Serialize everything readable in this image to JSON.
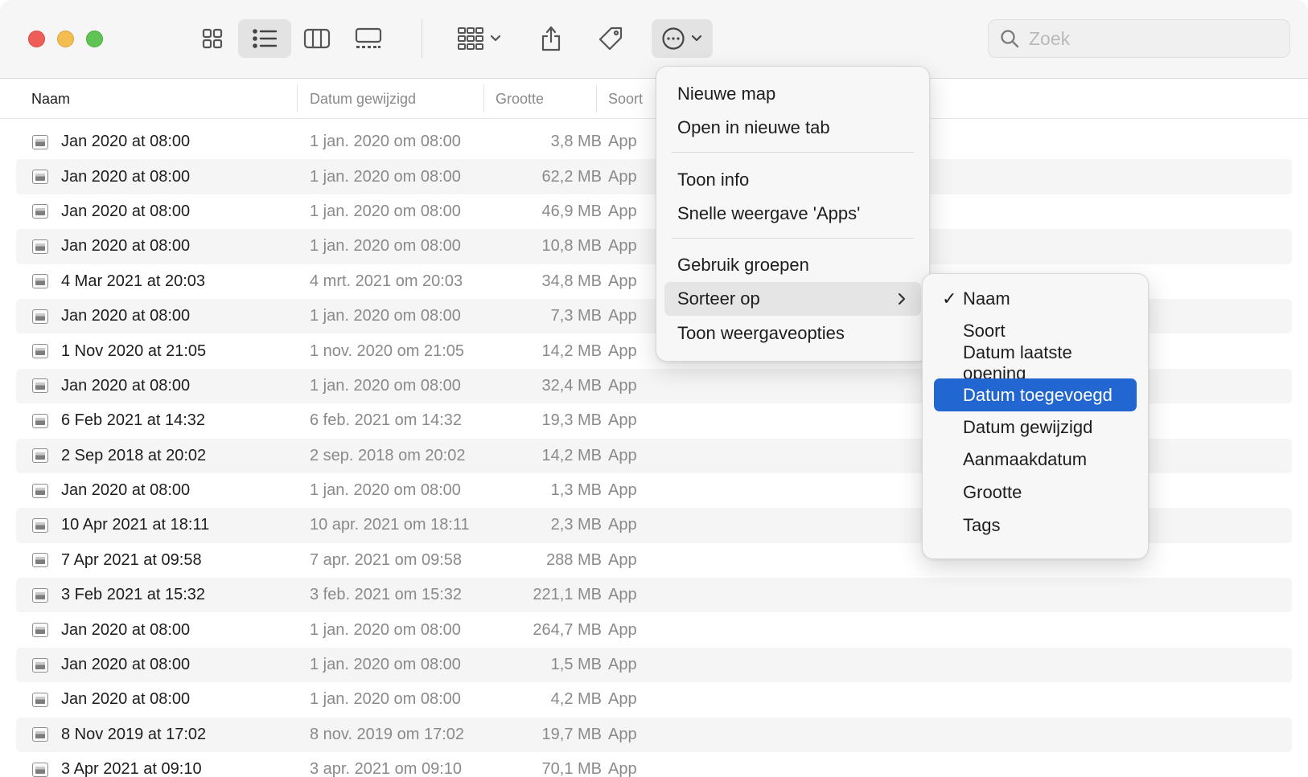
{
  "toolbar": {
    "view_icons": [
      "icon-view-icon",
      "list-view-icon",
      "column-view-icon",
      "gallery-view-icon"
    ],
    "search_placeholder": "Zoek"
  },
  "columns": {
    "name": "Naam",
    "date": "Datum gewijzigd",
    "size": "Grootte",
    "kind": "Soort"
  },
  "rows": [
    {
      "name": "Jan 2020 at 08:00",
      "date": "1 jan. 2020 om 08:00",
      "size": "3,8 MB",
      "kind": "App"
    },
    {
      "name": "Jan 2020 at 08:00",
      "date": "1 jan. 2020 om 08:00",
      "size": "62,2 MB",
      "kind": "App"
    },
    {
      "name": "Jan 2020 at 08:00",
      "date": "1 jan. 2020 om 08:00",
      "size": "46,9 MB",
      "kind": "App"
    },
    {
      "name": "Jan 2020 at 08:00",
      "date": "1 jan. 2020 om 08:00",
      "size": "10,8 MB",
      "kind": "App"
    },
    {
      "name": "4 Mar 2021 at 20:03",
      "date": "4 mrt. 2021 om 20:03",
      "size": "34,8 MB",
      "kind": "App"
    },
    {
      "name": "Jan 2020 at 08:00",
      "date": "1 jan. 2020 om 08:00",
      "size": "7,3 MB",
      "kind": "App"
    },
    {
      "name": "1 Nov 2020 at 21:05",
      "date": "1 nov. 2020 om 21:05",
      "size": "14,2 MB",
      "kind": "App"
    },
    {
      "name": "Jan 2020 at 08:00",
      "date": "1 jan. 2020 om 08:00",
      "size": "32,4 MB",
      "kind": "App"
    },
    {
      "name": "6 Feb 2021 at 14:32",
      "date": "6 feb. 2021 om 14:32",
      "size": "19,3 MB",
      "kind": "App"
    },
    {
      "name": "2 Sep 2018 at 20:02",
      "date": "2 sep. 2018 om 20:02",
      "size": "14,2 MB",
      "kind": "App"
    },
    {
      "name": "Jan 2020 at 08:00",
      "date": "1 jan. 2020 om 08:00",
      "size": "1,3 MB",
      "kind": "App"
    },
    {
      "name": "10 Apr 2021 at 18:11",
      "date": "10 apr. 2021 om 18:11",
      "size": "2,3 MB",
      "kind": "App"
    },
    {
      "name": "7 Apr 2021 at 09:58",
      "date": "7 apr. 2021 om 09:58",
      "size": "288 MB",
      "kind": "App"
    },
    {
      "name": "3 Feb 2021 at 15:32",
      "date": "3 feb. 2021 om 15:32",
      "size": "221,1 MB",
      "kind": "App"
    },
    {
      "name": "Jan 2020 at 08:00",
      "date": "1 jan. 2020 om 08:00",
      "size": "264,7 MB",
      "kind": "App"
    },
    {
      "name": "Jan 2020 at 08:00",
      "date": "1 jan. 2020 om 08:00",
      "size": "1,5 MB",
      "kind": "App"
    },
    {
      "name": "Jan 2020 at 08:00",
      "date": "1 jan. 2020 om 08:00",
      "size": "4,2 MB",
      "kind": "App"
    },
    {
      "name": "8 Nov 2019 at 17:02",
      "date": "8 nov. 2019 om 17:02",
      "size": "19,7 MB",
      "kind": "App"
    },
    {
      "name": "3 Apr 2021 at 09:10",
      "date": "3 apr. 2021 om 09:10",
      "size": "70,1 MB",
      "kind": "App"
    }
  ],
  "context_menu": {
    "new_folder": "Nieuwe map",
    "open_new_tab": "Open in nieuwe tab",
    "show_info": "Toon info",
    "quick_look": "Snelle weergave 'Apps'",
    "use_groups": "Gebruik groepen",
    "sort_by": "Sorteer op",
    "view_options": "Toon weergaveopties"
  },
  "sort_submenu": {
    "checked_item": "Naam",
    "highlighted_item": "Datum toegevoegd",
    "items": [
      "Naam",
      "Soort",
      "Datum laatste opening",
      "Datum toegevoegd",
      "Datum gewijzigd",
      "Aanmaakdatum",
      "Grootte",
      "Tags"
    ]
  },
  "colors": {
    "accent": "#2166d1",
    "close": "#ee5e56",
    "minimize": "#f4bd4f",
    "zoom": "#5fc453"
  }
}
